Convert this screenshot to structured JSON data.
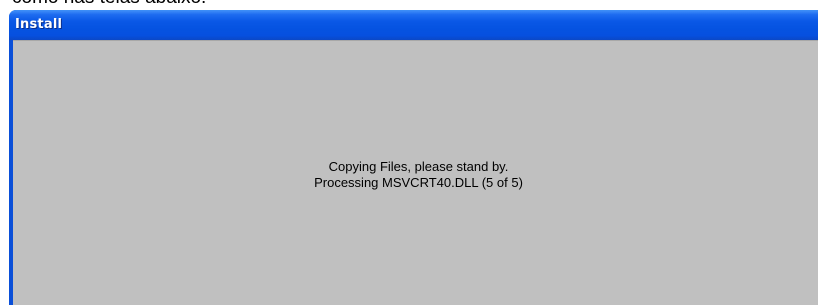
{
  "caption_above": "como nas telas abaixo:",
  "window": {
    "title": "Install"
  },
  "status": {
    "line1": "Copying Files, please stand by.",
    "line2": "Processing MSVCRT40.DLL (5 of 5)"
  },
  "colors": {
    "titlebar_blue": "#0553e1",
    "client_gray": "#c0c0c0"
  }
}
